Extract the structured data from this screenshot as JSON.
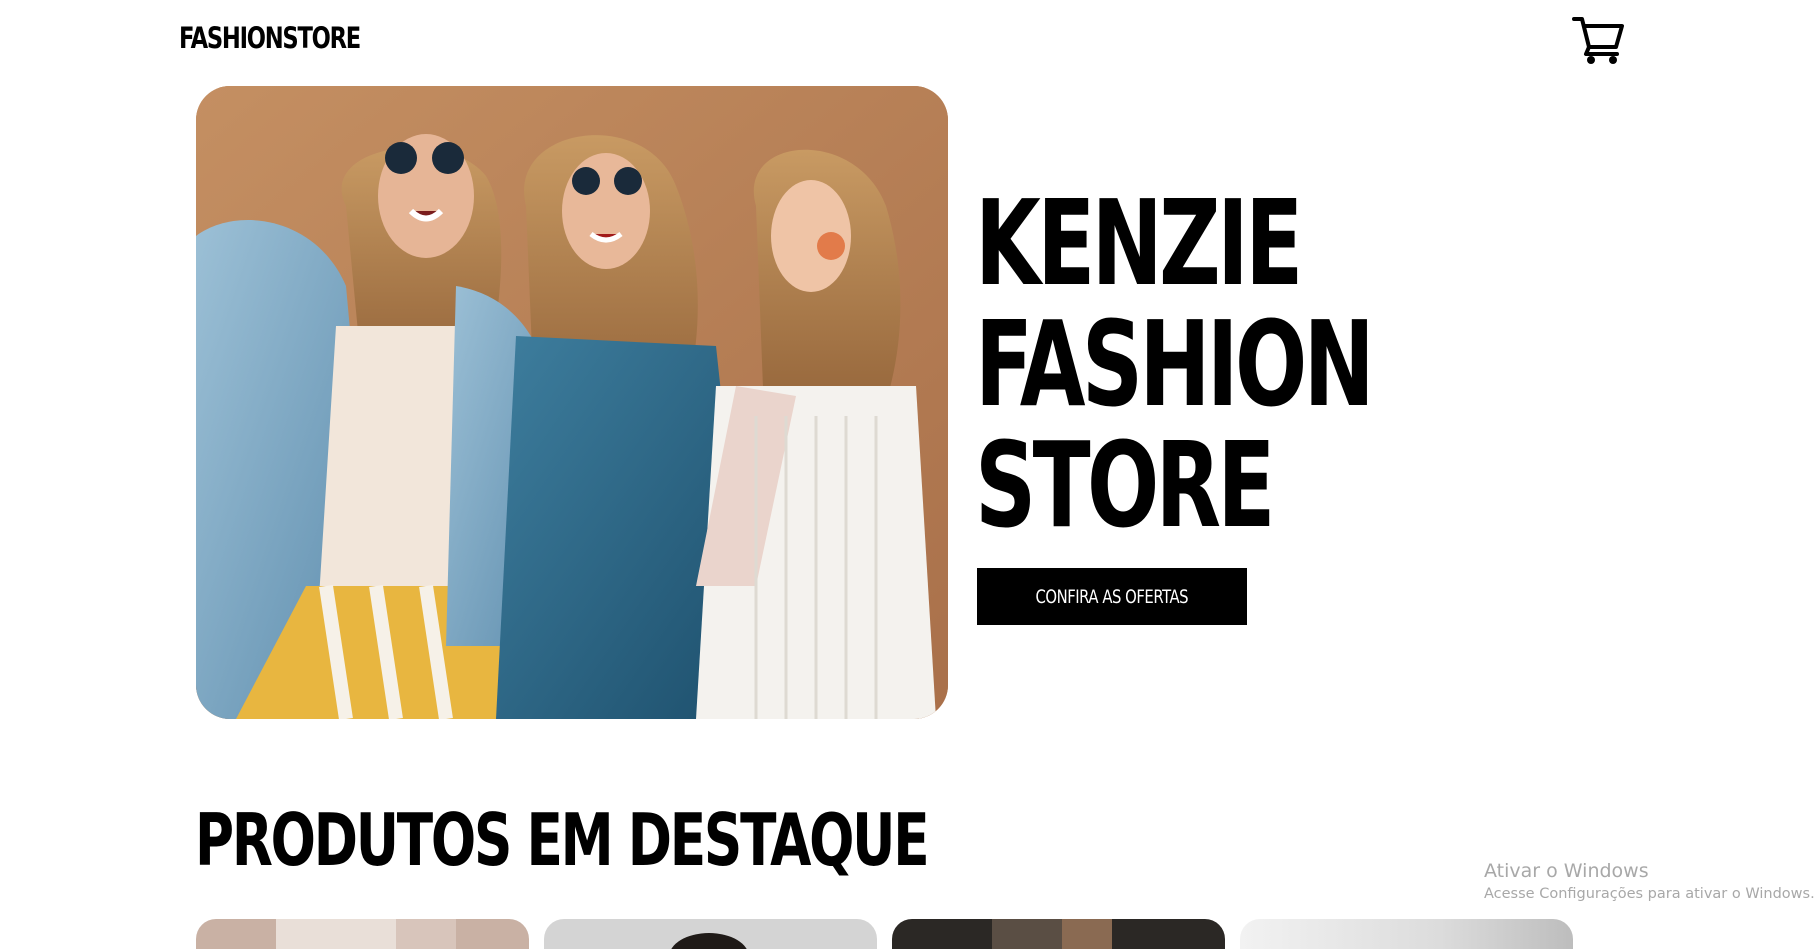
{
  "header": {
    "logo": "FASHIONSTORE",
    "cart_icon": "shopping-cart-icon"
  },
  "hero": {
    "image_alt": "three women wearing sunglasses laughing",
    "title_lines": [
      "KENZIE",
      "FASHION",
      "STORE"
    ],
    "cta_label": "CONFIRA AS OFERTAS"
  },
  "featured": {
    "title": "PRODUTOS EM DESTAQUE",
    "products": [
      {
        "image": "product-image-1"
      },
      {
        "image": "product-image-2"
      },
      {
        "image": "product-image-3"
      },
      {
        "image": "product-image-4"
      }
    ]
  },
  "watermark": {
    "line1": "Ativar o Windows",
    "line2": "Acesse Configurações para ativar o Windows."
  },
  "colors": {
    "background": "#ffffff",
    "text": "#000000",
    "button_bg": "#000000",
    "button_text": "#ffffff",
    "hero_backdrop": "#b98258"
  }
}
